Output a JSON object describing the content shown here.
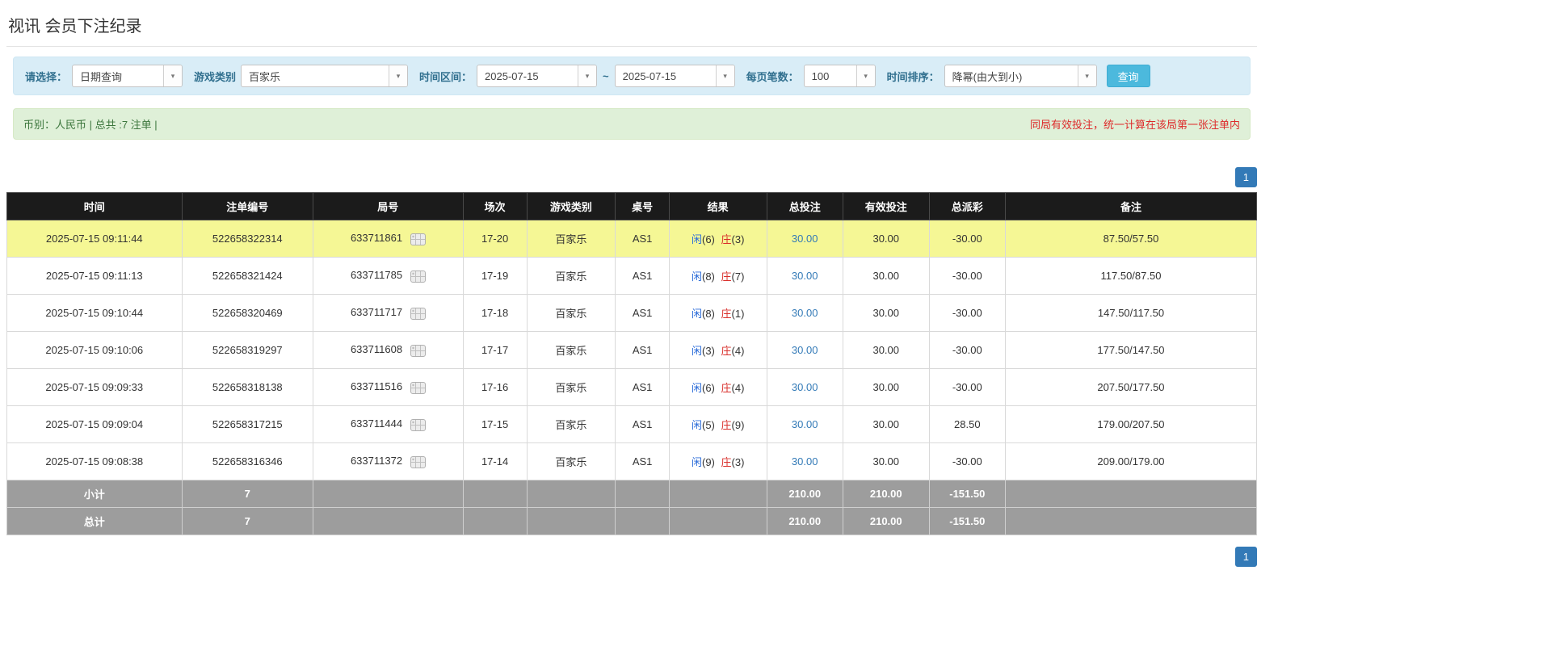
{
  "page": {
    "title": "视讯 会员下注纪录"
  },
  "filters": {
    "select_label": "请选择：",
    "select_value": "日期查询",
    "game_label": "游戏类别",
    "game_value": "百家乐",
    "range_label": "时间区间：",
    "date_from": "2025-07-15",
    "tilde": "~",
    "date_to": "2025-07-15",
    "page_size_label": "每页笔数：",
    "page_size_value": "100",
    "sort_label": "时间排序：",
    "sort_value": "降幂(由大到小)",
    "search_button": "查询"
  },
  "summary": {
    "left": "币别：人民币 | 总共 :7 注单 |",
    "right_notice": "同局有效投注，统一计算在该局第一张注单内"
  },
  "pagination": {
    "page": "1"
  },
  "icons": {
    "dropdown_caret": "▾",
    "round_detail": "round-grid-icon"
  },
  "colors": {
    "filter_bar_bg": "#d9edf7",
    "summary_bar_bg": "#dff0d8",
    "table_header_bg": "#1b1b1b",
    "highlight_row_bg": "#f5f795",
    "footer_row_bg": "#9d9d9d",
    "accent_blue": "#337ab7",
    "player_blue": "#2b6cd9",
    "banker_red": "#d9302c",
    "negative_red": "#e02b2b",
    "search_button_bg": "#4cb9dd"
  },
  "table": {
    "headers": [
      "时间",
      "注单编号",
      "局号",
      "场次",
      "游戏类别",
      "桌号",
      "结果",
      "总投注",
      "有效投注",
      "总派彩",
      "备注"
    ],
    "rows": [
      {
        "time": "2025-07-15 09:11:44",
        "bet_id": "522658322314",
        "round_id": "633711861",
        "session": "17-20",
        "game": "百家乐",
        "table_no": "AS1",
        "result_player_label": "闲",
        "result_player_score": "(6)",
        "result_banker_label": "庄",
        "result_banker_score": "(3)",
        "total_bet": "30.00",
        "valid_bet": "30.00",
        "payout": "-30.00",
        "remark": "87.50/57.50"
      },
      {
        "time": "2025-07-15 09:11:13",
        "bet_id": "522658321424",
        "round_id": "633711785",
        "session": "17-19",
        "game": "百家乐",
        "table_no": "AS1",
        "result_player_label": "闲",
        "result_player_score": "(8)",
        "result_banker_label": "庄",
        "result_banker_score": "(7)",
        "total_bet": "30.00",
        "valid_bet": "30.00",
        "payout": "-30.00",
        "remark": "117.50/87.50"
      },
      {
        "time": "2025-07-15 09:10:44",
        "bet_id": "522658320469",
        "round_id": "633711717",
        "session": "17-18",
        "game": "百家乐",
        "table_no": "AS1",
        "result_player_label": "闲",
        "result_player_score": "(8)",
        "result_banker_label": "庄",
        "result_banker_score": "(1)",
        "total_bet": "30.00",
        "valid_bet": "30.00",
        "payout": "-30.00",
        "remark": "147.50/117.50"
      },
      {
        "time": "2025-07-15 09:10:06",
        "bet_id": "522658319297",
        "round_id": "633711608",
        "session": "17-17",
        "game": "百家乐",
        "table_no": "AS1",
        "result_player_label": "闲",
        "result_player_score": "(3)",
        "result_banker_label": "庄",
        "result_banker_score": "(4)",
        "total_bet": "30.00",
        "valid_bet": "30.00",
        "payout": "-30.00",
        "remark": "177.50/147.50"
      },
      {
        "time": "2025-07-15 09:09:33",
        "bet_id": "522658318138",
        "round_id": "633711516",
        "session": "17-16",
        "game": "百家乐",
        "table_no": "AS1",
        "result_player_label": "闲",
        "result_player_score": "(6)",
        "result_banker_label": "庄",
        "result_banker_score": "(4)",
        "total_bet": "30.00",
        "valid_bet": "30.00",
        "payout": "-30.00",
        "remark": "207.50/177.50"
      },
      {
        "time": "2025-07-15 09:09:04",
        "bet_id": "522658317215",
        "round_id": "633711444",
        "session": "17-15",
        "game": "百家乐",
        "table_no": "AS1",
        "result_player_label": "闲",
        "result_player_score": "(5)",
        "result_banker_label": "庄",
        "result_banker_score": "(9)",
        "total_bet": "30.00",
        "valid_bet": "30.00",
        "payout": "28.50",
        "remark": "179.00/207.50"
      },
      {
        "time": "2025-07-15 09:08:38",
        "bet_id": "522658316346",
        "round_id": "633711372",
        "session": "17-14",
        "game": "百家乐",
        "table_no": "AS1",
        "result_player_label": "闲",
        "result_player_score": "(9)",
        "result_banker_label": "庄",
        "result_banker_score": "(3)",
        "total_bet": "30.00",
        "valid_bet": "30.00",
        "payout": "-30.00",
        "remark": "209.00/179.00"
      }
    ],
    "subtotal": {
      "label": "小计",
      "count": "7",
      "total_bet": "210.00",
      "valid_bet": "210.00",
      "payout": "-151.50"
    },
    "total": {
      "label": "总计",
      "count": "7",
      "total_bet": "210.00",
      "valid_bet": "210.00",
      "payout": "-151.50"
    }
  }
}
